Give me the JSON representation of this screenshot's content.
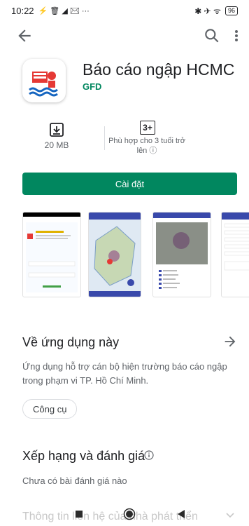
{
  "status_bar": {
    "time": "10:22",
    "left_icons": "⚡ 🗑 ◢ ✉ ···",
    "right_icons": "✱ ✈ ᯤ",
    "battery": "96"
  },
  "app": {
    "title": "Báo cáo ngập HCMC",
    "developer": "GFD"
  },
  "meta": {
    "size": "20 MB",
    "rating_badge": "3+",
    "rating_text": "Phù hợp cho 3 tuổi trở lên ⓘ"
  },
  "install_label": "Cài đặt",
  "about": {
    "title": "Về ứng dụng này",
    "description": "Ứng dụng hỗ trợ cán bộ hiện trường báo cáo ngập trong phạm vi TP. Hồ Chí Minh.",
    "chip": "Công cụ"
  },
  "ratings": {
    "title": "Xếp hạng và đánh giá",
    "empty": "Chưa có bài đánh giá nào"
  },
  "contact_title": "Thông tin liên hệ của nhà phát triển",
  "icons": [
    "back-arrow-icon",
    "search-icon",
    "more-vert-icon",
    "download-icon",
    "arrow-right-icon",
    "info-icon",
    "chevron-down-icon"
  ],
  "colors": {
    "accent": "#01875f"
  }
}
